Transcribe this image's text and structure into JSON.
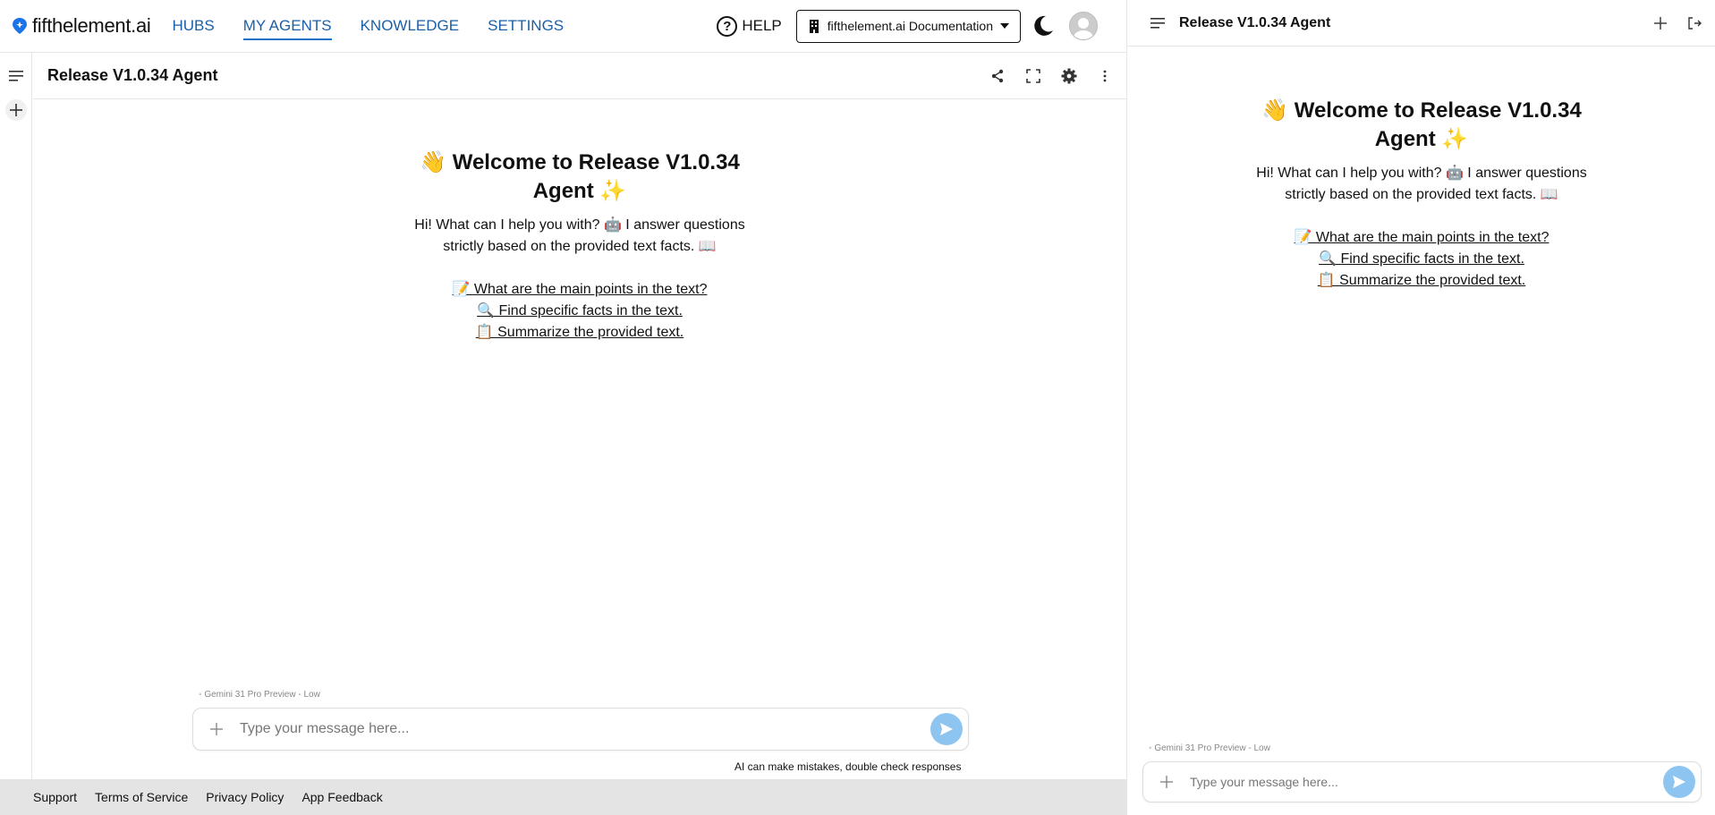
{
  "app": {
    "logo_text": "fifthelement.ai",
    "nav": [
      {
        "label": "HUBS",
        "active": false
      },
      {
        "label": "MY AGENTS",
        "active": true
      },
      {
        "label": "KNOWLEDGE",
        "active": false
      },
      {
        "label": "SETTINGS",
        "active": false
      }
    ],
    "help_label": "HELP",
    "workspace_label": "fifthelement.ai Documentation",
    "accent_color": "#1a5fa8"
  },
  "agent": {
    "title": "Release V1.0.34 Agent",
    "welcome_line1": "👋 Welcome to Release V1.0.34",
    "welcome_line2": "Agent ✨",
    "intro_line1": "Hi! What can I help you with? 🤖 I answer questions",
    "intro_line2": "strictly based on the provided text facts. 📖",
    "suggestions": [
      "📝 What are the main points in the text?",
      "🔍 Find specific facts in the text.",
      "📋 Summarize the provided text."
    ],
    "model_label": "◦ Gemini 31 Pro Preview - Low",
    "input_placeholder": "Type your message here...",
    "disclaimer": "AI can make mistakes, double check responses"
  },
  "footer": {
    "links": [
      "Support",
      "Terms of Service",
      "Privacy Policy",
      "App Feedback"
    ]
  },
  "panel": {
    "title": "Release V1.0.34 Agent",
    "model_label": "◦ Gemini 31 Pro Preview - Low",
    "input_placeholder": "Type your message here..."
  }
}
